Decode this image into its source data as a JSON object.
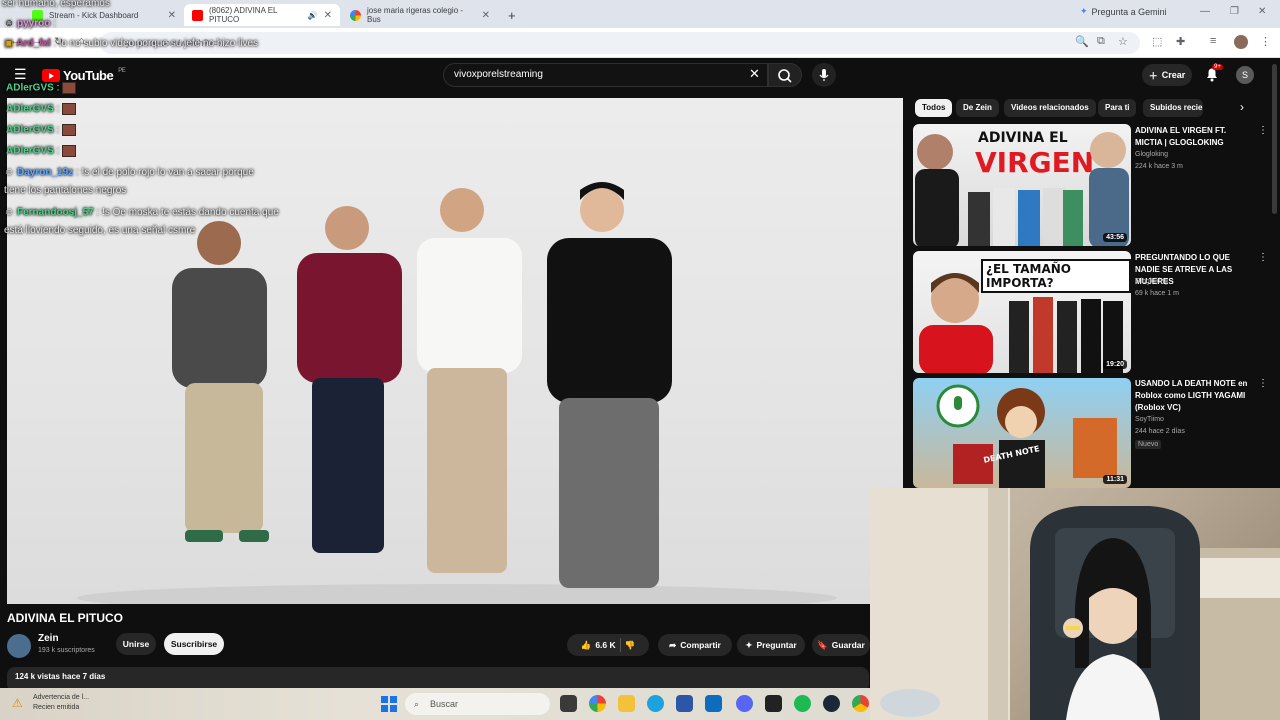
{
  "browser": {
    "tabs": [
      {
        "label": "Stream - Kick Dashboard",
        "active": false
      },
      {
        "label": "(8062) ADIVINA EL PITUCO",
        "active": true
      },
      {
        "label": "jose maria rigeras colegio - Bus",
        "active": false
      }
    ],
    "new_tab": "+",
    "gemini_label": "Pregunta a Gemini",
    "address": "youtube.com/watch?v=..."
  },
  "youtube": {
    "logo_text": "YouTube",
    "logo_region": "PE",
    "search_value": "vivoxporelstreaming",
    "create_label": "Crear",
    "notif_count": "9+",
    "avatar_letter": "S",
    "video": {
      "title": "ADIVINA EL PITUCO",
      "channel": "Zein",
      "subscribers": "193 k suscriptores",
      "join_label": "Unirse",
      "subscribe_label": "Suscribirse",
      "likes": "6.6 K",
      "share_label": "Compartir",
      "ask_label": "Preguntar",
      "save_label": "Guardar",
      "views": "124 k vistas  hace 7 días"
    },
    "chips": [
      "Todos",
      "De Zein",
      "Videos relacionados",
      "Para ti",
      "Subidos recientem"
    ],
    "recommendations": [
      {
        "title": "ADIVINA EL VIRGEN FT. MICTIA | GLOGLOKING",
        "channel": "Glogloking",
        "meta": "224 k  hace 3 m",
        "duration": "43:56",
        "thumb_top": "ADIVINA EL",
        "thumb_main": "VIRGEN",
        "badge": ""
      },
      {
        "title": "PREGUNTANDO LO QUE NADIE SE ATREVE A LAS MUJERES",
        "channel": "Glogloking",
        "meta": "69 k  hace 1 m",
        "duration": "19:20",
        "thumb_top": "¿EL TAMAÑO IMPORTA?",
        "thumb_main": "",
        "badge": ""
      },
      {
        "title": "USANDO LA DEATH NOTE en Roblox como LIGTH YAGAMI (Roblox VC)",
        "channel": "SoyTiimo",
        "meta": "244  hace 2 días",
        "duration": "11:31",
        "thumb_top": "DEATH NOTE",
        "thumb_main": "",
        "badge": "Nuevo"
      }
    ]
  },
  "chat": [
    {
      "user": "ser humano, esperamos",
      "text": ""
    },
    {
      "user": "pyyroo",
      "text": ":"
    },
    {
      "user": "Ard_fxl",
      "text": ": lo no subio video porque su jefe no hizo lives"
    },
    {
      "user": "ADlerGVS",
      "text": ":"
    },
    {
      "user": "ADlerGVS",
      "text": ":"
    },
    {
      "user": "ADlerGVS",
      "text": ":"
    },
    {
      "user": "ADlerGVS",
      "text": ":"
    },
    {
      "user": "Dayron_19z",
      "text": ": !s el de polo rojo lo van a sacar porque"
    },
    {
      "user": "",
      "text": "tiene los pantalones negros"
    },
    {
      "user": "Fernandoosj_57",
      "text": ": !s Oe moska te estás dando cuenta que"
    },
    {
      "user": "",
      "text": "está lloviendo seguido, es una señal csmre"
    }
  ],
  "taskbar": {
    "notice_title": "Advertencia de l...",
    "notice_sub": "Recien emitida",
    "search_placeholder": "Buscar"
  },
  "colors": {
    "yt_bg": "#0f0f0f",
    "yt_red": "#ff0000",
    "chat_green": "#4ed18a",
    "chat_blue": "#62a8ff"
  }
}
